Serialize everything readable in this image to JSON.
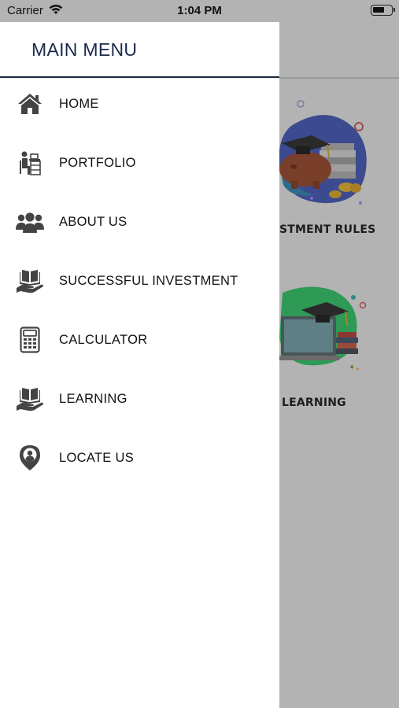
{
  "status_bar": {
    "carrier": "Carrier",
    "time": "1:04 PM"
  },
  "drawer": {
    "title": "MAIN MENU",
    "items": [
      {
        "label": "HOME",
        "icon": "home-icon"
      },
      {
        "label": "PORTFOLIO",
        "icon": "portfolio-icon"
      },
      {
        "label": "ABOUT US",
        "icon": "people-icon"
      },
      {
        "label": "SUCCESSFUL INVESTMENT",
        "icon": "hand-book-icon"
      },
      {
        "label": "CALCULATOR",
        "icon": "calculator-icon"
      },
      {
        "label": "LEARNING",
        "icon": "hand-book-icon"
      },
      {
        "label": "LOCATE US",
        "icon": "location-pin-icon"
      }
    ]
  },
  "background": {
    "card_1_label": "STMENT RULES",
    "card_2_label": "LEARNING"
  },
  "colors": {
    "title": "#1b2a4a",
    "icon": "#444444",
    "overlay": "#b3b3b3"
  }
}
